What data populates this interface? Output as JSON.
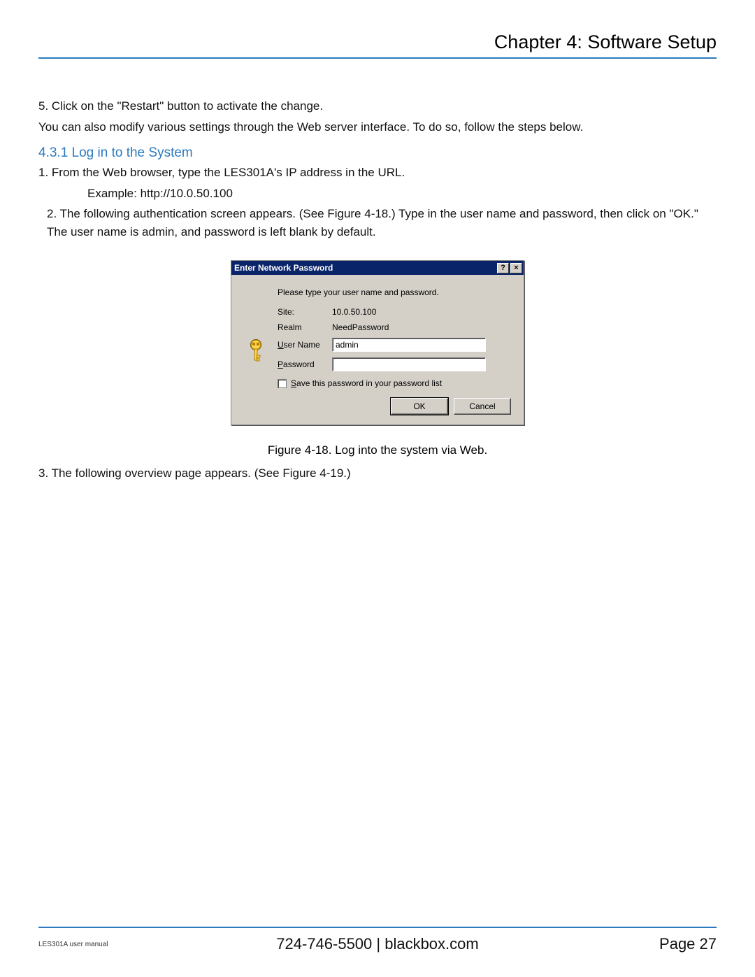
{
  "header": {
    "chapter_title": "Chapter 4: Software Setup"
  },
  "body": {
    "step5": "5. Click on the \"Restart\" button to activate the change.",
    "para_modify": "You can also modify various settings through the Web server interface. To do so, follow the steps below.",
    "section_heading": "4.3.1 Log in to the System",
    "step1": "1. From the Web browser, type the LES301A's IP address in the URL.",
    "example_line": "Example: http://10.0.50.100",
    "step2": "2. The following authentication screen appears. (See Figure 4-18.) Type in the user name and password, then click on \"OK.\" The user name is admin, and password is left blank by default.",
    "figure_caption": "Figure 4-18. Log into the system via Web.",
    "step3": "3. The following overview page appears. (See Figure 4-19.)"
  },
  "dialog": {
    "title": "Enter Network Password",
    "help_glyph": "?",
    "close_glyph": "×",
    "instruction": "Please type your user name and password.",
    "site_label": "Site:",
    "site_value": "10.0.50.100",
    "realm_label": "Realm",
    "realm_value": "NeedPassword",
    "username_label": "User Name",
    "username_value": "admin",
    "password_label": "Password",
    "password_value": "",
    "save_label": "Save this password in your password list",
    "ok_label": "OK",
    "cancel_label": "Cancel"
  },
  "footer": {
    "left": "LES301A user manual",
    "center": "724-746-5500   |   blackbox.com",
    "right": "Page 27"
  }
}
